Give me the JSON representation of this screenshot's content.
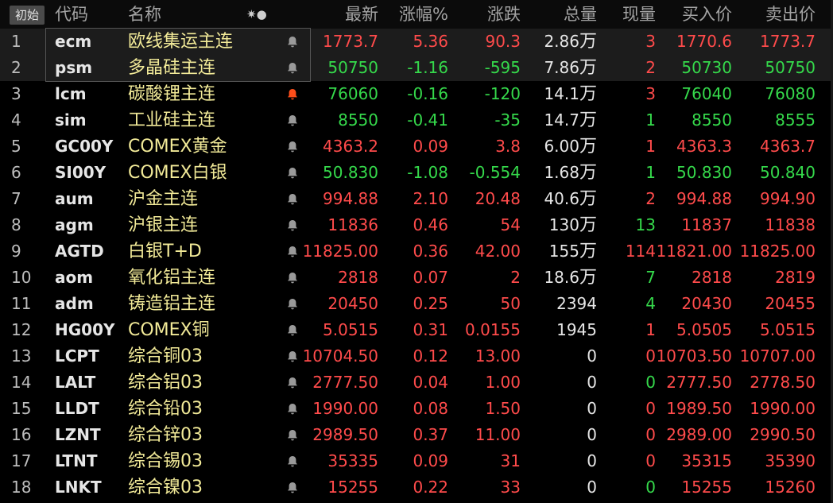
{
  "header": {
    "first_label": "初始",
    "columns": [
      "代码",
      "名称",
      "最新",
      "涨幅%",
      "涨跌",
      "总量",
      "现量",
      "买入价",
      "卖出价"
    ],
    "settings_icons": "✷●"
  },
  "colors": {
    "up": "#ff4b4b",
    "down": "#35d94b",
    "flat": "#e6e6e6",
    "name": "#f2ea98",
    "alert_bell": "#ff4e1a"
  },
  "rows": [
    {
      "idx": "1",
      "code": "ecm",
      "name": "欧线集运主连",
      "bell": "bell-icon",
      "alert": false,
      "price": "1773.7",
      "pct": "5.36",
      "chg": "90.3",
      "vol": "2.86",
      "vol_unit": "万",
      "cur": "3",
      "bid": "1770.6",
      "ask": "1773.7",
      "dir": "red",
      "cur_dir": "red"
    },
    {
      "idx": "2",
      "code": "psm",
      "name": "多晶硅主连",
      "bell": "bell-icon",
      "alert": false,
      "price": "50750",
      "pct": "-1.16",
      "chg": "-595",
      "vol": "7.86",
      "vol_unit": "万",
      "cur": "2",
      "bid": "50730",
      "ask": "50750",
      "dir": "green",
      "cur_dir": "red"
    },
    {
      "idx": "3",
      "code": "lcm",
      "name": "碳酸锂主连",
      "bell": "bell-icon",
      "alert": true,
      "price": "76060",
      "pct": "-0.16",
      "chg": "-120",
      "vol": "14.1",
      "vol_unit": "万",
      "cur": "3",
      "bid": "76040",
      "ask": "76080",
      "dir": "green",
      "cur_dir": "red"
    },
    {
      "idx": "4",
      "code": "sim",
      "name": "工业硅主连",
      "bell": "bell-icon",
      "alert": false,
      "price": "8550",
      "pct": "-0.41",
      "chg": "-35",
      "vol": "14.7",
      "vol_unit": "万",
      "cur": "1",
      "bid": "8550",
      "ask": "8555",
      "dir": "green",
      "cur_dir": "green"
    },
    {
      "idx": "5",
      "code": "GC00Y",
      "name": "COMEX黄金",
      "bell": "bell-icon",
      "alert": false,
      "price": "4363.2",
      "pct": "0.09",
      "chg": "3.8",
      "vol": "6.00",
      "vol_unit": "万",
      "cur": "1",
      "bid": "4363.3",
      "ask": "4363.7",
      "dir": "red",
      "cur_dir": "red"
    },
    {
      "idx": "6",
      "code": "SI00Y",
      "name": "COMEX白银",
      "bell": "bell-icon",
      "alert": false,
      "price": "50.830",
      "pct": "-1.08",
      "chg": "-0.554",
      "vol": "1.68",
      "vol_unit": "万",
      "cur": "1",
      "bid": "50.830",
      "ask": "50.840",
      "dir": "green",
      "cur_dir": "green"
    },
    {
      "idx": "7",
      "code": "aum",
      "name": "沪金主连",
      "bell": "bell-icon",
      "alert": false,
      "price": "994.88",
      "pct": "2.10",
      "chg": "20.48",
      "vol": "40.6",
      "vol_unit": "万",
      "cur": "2",
      "bid": "994.88",
      "ask": "994.90",
      "dir": "red",
      "cur_dir": "red"
    },
    {
      "idx": "8",
      "code": "agm",
      "name": "沪银主连",
      "bell": "bell-icon",
      "alert": false,
      "price": "11836",
      "pct": "0.46",
      "chg": "54",
      "vol": "130",
      "vol_unit": "万",
      "cur": "13",
      "bid": "11837",
      "ask": "11838",
      "dir": "red",
      "cur_dir": "green"
    },
    {
      "idx": "9",
      "code": "AGTD",
      "name": "白银T+D",
      "bell": "bell-icon",
      "alert": false,
      "price": "11825.00",
      "pct": "0.36",
      "chg": "42.00",
      "vol": "155",
      "vol_unit": "万",
      "cur": "114",
      "bid": "11821.00",
      "ask": "11825.00",
      "dir": "red",
      "cur_dir": "red"
    },
    {
      "idx": "10",
      "code": "aom",
      "name": "氧化铝主连",
      "bell": "bell-icon",
      "alert": false,
      "price": "2818",
      "pct": "0.07",
      "chg": "2",
      "vol": "18.6",
      "vol_unit": "万",
      "cur": "7",
      "bid": "2818",
      "ask": "2819",
      "dir": "red",
      "cur_dir": "green"
    },
    {
      "idx": "11",
      "code": "adm",
      "name": "铸造铝主连",
      "bell": "bell-icon",
      "alert": false,
      "price": "20450",
      "pct": "0.25",
      "chg": "50",
      "vol": "2394",
      "vol_unit": "",
      "cur": "4",
      "bid": "20430",
      "ask": "20455",
      "dir": "red",
      "cur_dir": "green"
    },
    {
      "idx": "12",
      "code": "HG00Y",
      "name": "COMEX铜",
      "bell": "bell-icon",
      "alert": false,
      "price": "5.0515",
      "pct": "0.31",
      "chg": "0.0155",
      "vol": "1945",
      "vol_unit": "",
      "cur": "1",
      "bid": "5.0505",
      "ask": "5.0515",
      "dir": "red",
      "cur_dir": "red"
    },
    {
      "idx": "13",
      "code": "LCPT",
      "name": "综合铜03",
      "bell": "bell-icon",
      "alert": false,
      "price": "10704.50",
      "pct": "0.12",
      "chg": "13.00",
      "vol": "0",
      "vol_unit": "",
      "cur": "0",
      "bid": "10703.50",
      "ask": "10707.00",
      "dir": "red",
      "cur_dir": "red"
    },
    {
      "idx": "14",
      "code": "LALT",
      "name": "综合铝03",
      "bell": "bell-icon",
      "alert": false,
      "price": "2777.50",
      "pct": "0.04",
      "chg": "1.00",
      "vol": "0",
      "vol_unit": "",
      "cur": "0",
      "bid": "2777.50",
      "ask": "2778.50",
      "dir": "red",
      "cur_dir": "green"
    },
    {
      "idx": "15",
      "code": "LLDT",
      "name": "综合铅03",
      "bell": "bell-icon",
      "alert": false,
      "price": "1990.00",
      "pct": "0.08",
      "chg": "1.50",
      "vol": "0",
      "vol_unit": "",
      "cur": "0",
      "bid": "1989.50",
      "ask": "1990.00",
      "dir": "red",
      "cur_dir": "red"
    },
    {
      "idx": "16",
      "code": "LZNT",
      "name": "综合锌03",
      "bell": "bell-icon",
      "alert": false,
      "price": "2989.50",
      "pct": "0.37",
      "chg": "11.00",
      "vol": "0",
      "vol_unit": "",
      "cur": "0",
      "bid": "2989.00",
      "ask": "2990.50",
      "dir": "red",
      "cur_dir": "red"
    },
    {
      "idx": "17",
      "code": "LTNT",
      "name": "综合锡03",
      "bell": "bell-icon",
      "alert": false,
      "price": "35335",
      "pct": "0.09",
      "chg": "31",
      "vol": "0",
      "vol_unit": "",
      "cur": "0",
      "bid": "35315",
      "ask": "35390",
      "dir": "red",
      "cur_dir": "red"
    },
    {
      "idx": "18",
      "code": "LNKT",
      "name": "综合镍03",
      "bell": "bell-icon",
      "alert": false,
      "price": "15255",
      "pct": "0.22",
      "chg": "33",
      "vol": "0",
      "vol_unit": "",
      "cur": "0",
      "bid": "15255",
      "ask": "15260",
      "dir": "red",
      "cur_dir": "green"
    }
  ]
}
